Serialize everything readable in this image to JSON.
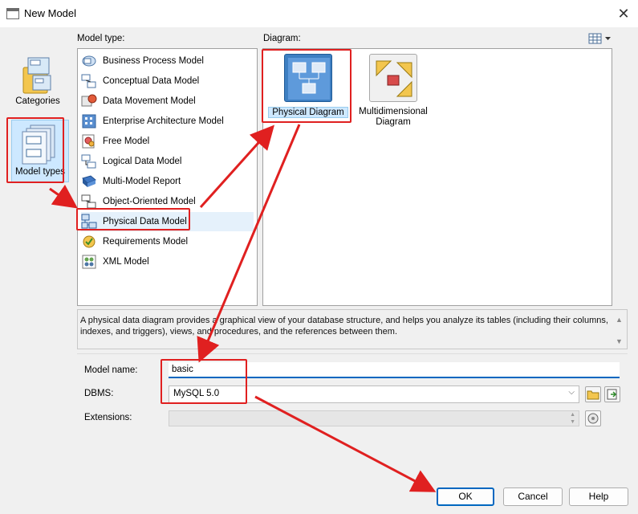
{
  "window": {
    "title": "New Model",
    "close_glyph": "✕"
  },
  "categories": {
    "categories_label": "Categories",
    "model_types_label": "Model types"
  },
  "labels": {
    "model_type": "Model type:",
    "diagram": "Diagram:"
  },
  "model_types": [
    {
      "label": "Business Process Model",
      "icon": "business-process-icon"
    },
    {
      "label": "Conceptual Data Model",
      "icon": "conceptual-data-icon"
    },
    {
      "label": "Data Movement Model",
      "icon": "data-movement-icon"
    },
    {
      "label": "Enterprise Architecture Model",
      "icon": "enterprise-architecture-icon"
    },
    {
      "label": "Free Model",
      "icon": "free-model-icon"
    },
    {
      "label": "Logical Data Model",
      "icon": "logical-data-icon"
    },
    {
      "label": "Multi-Model Report",
      "icon": "multi-model-report-icon"
    },
    {
      "label": "Object-Oriented Model",
      "icon": "object-oriented-icon"
    },
    {
      "label": "Physical Data Model",
      "icon": "physical-data-icon",
      "selected": true
    },
    {
      "label": "Requirements Model",
      "icon": "requirements-icon"
    },
    {
      "label": "XML Model",
      "icon": "xml-model-icon"
    }
  ],
  "diagrams": [
    {
      "label": "Physical Diagram",
      "selected": true
    },
    {
      "label_line1": "Multidimensional",
      "label_line2": "Diagram"
    }
  ],
  "description": "A physical data diagram provides a graphical view of your database structure, and helps you analyze its tables (including their columns, indexes, and triggers), views, and procedures, and the references between them.",
  "form": {
    "model_name_label": "Model name:",
    "model_name_value": "basic",
    "dbms_label": "DBMS:",
    "dbms_value": "MySQL 5.0",
    "extensions_label": "Extensions:"
  },
  "buttons": {
    "ok": "OK",
    "cancel": "Cancel",
    "help": "Help"
  },
  "colors": {
    "annotation": "#e02020",
    "accent": "#0067c0",
    "selection": "#cde8ff"
  }
}
